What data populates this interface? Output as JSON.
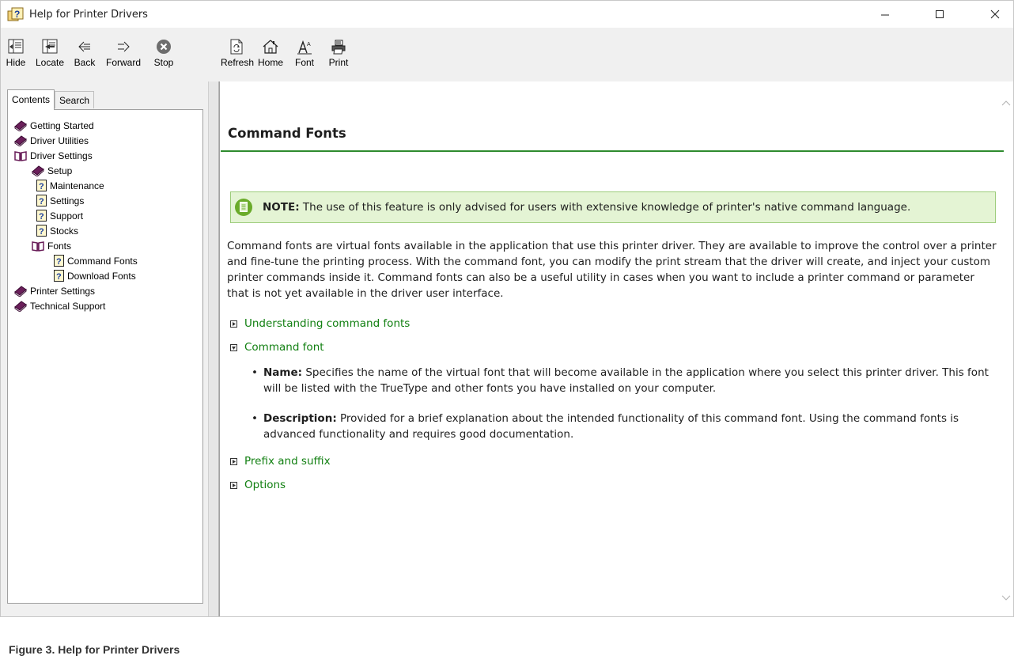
{
  "window": {
    "title": "Help for Printer Drivers",
    "controls": [
      "–",
      "□",
      "×"
    ]
  },
  "toolbar": {
    "hide": "Hide",
    "locate": "Locate",
    "back": "Back",
    "forward": "Forward",
    "stop": "Stop",
    "refresh": "Refresh",
    "home": "Home",
    "font": "Font",
    "print": "Print"
  },
  "tabs": {
    "contents": "Contents",
    "search": "Search"
  },
  "tree": {
    "getting_started": "Getting Started",
    "driver_utilities": "Driver Utilities",
    "driver_settings": "Driver Settings",
    "setup": "Setup",
    "maintenance": "Maintenance",
    "settings": "Settings",
    "support": "Support",
    "stocks": "Stocks",
    "fonts": "Fonts",
    "command_fonts": "Command Fonts",
    "download_fonts": "Download Fonts",
    "printer_settings": "Printer Settings",
    "technical_support": "Technical Support"
  },
  "content": {
    "title": "Command Fonts",
    "note_label": "NOTE:",
    "note_text": " The use of this feature is only advised for users with extensive knowledge of printer's native command language.",
    "intro": "Command fonts are virtual fonts available in the application that use this printer driver. They are available to improve the control over a printer and fine-tune the printing process. With the command font, you can modify the print stream that the driver will create, and inject your custom printer commands inside it. Command fonts can also be a useful utility in cases when you want to include a printer command or parameter that is not yet available in the driver user interface.",
    "sections": {
      "understanding": "Understanding command fonts",
      "command_font": "Command font",
      "prefix_suffix": "Prefix and suffix",
      "options": "Options"
    },
    "bullets": {
      "name_label": "Name:",
      "name_text": " Specifies the name of the virtual font that will become available in the application where you select this printer driver. This font will be listed with the TrueType and other fonts you have installed on your computer.",
      "desc_label": "Description:",
      "desc_text": " Provided for a brief explanation about the intended functionality of this command font. Using the command fonts is advanced functionality and requires good documentation."
    }
  },
  "caption": "Figure 3.  Help for Printer Drivers",
  "colors": {
    "link_green": "#128012",
    "title_rule": "#2e8b2e",
    "note_bg": "#e4f4d4",
    "book_purple": "#6a1f5a"
  }
}
